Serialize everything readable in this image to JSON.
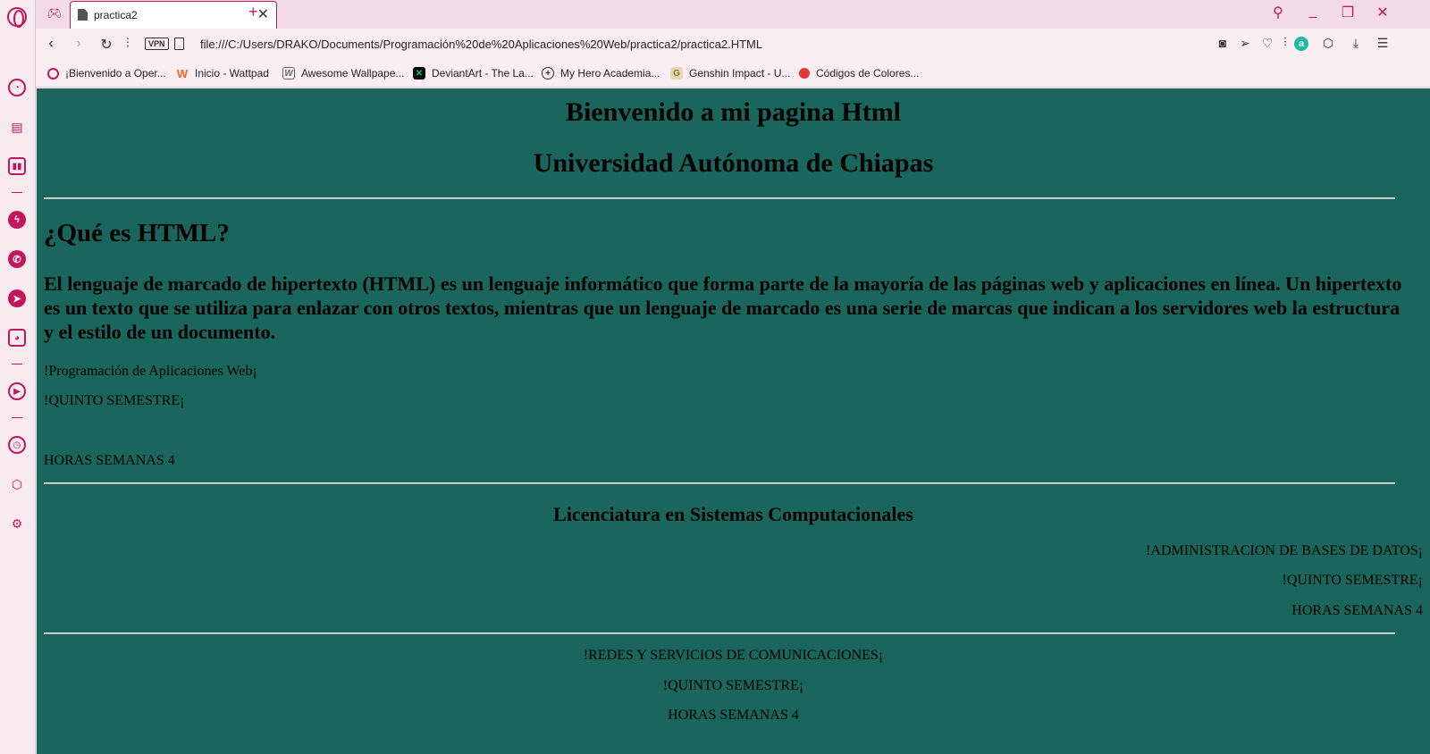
{
  "browser": {
    "tab": {
      "title": "practica2"
    },
    "address": {
      "vpn_label": "VPN",
      "url": "file:///C:/Users/DRAKO/Documents/Programación%20de%20Aplicaciones%20Web/practica2/practica2.HTML"
    },
    "bookmarks": [
      {
        "label": "¡Bienvenido a Oper...",
        "icon": "opera-icon",
        "color": "#c2185b"
      },
      {
        "label": "Inicio - Wattpad",
        "icon": "wattpad-icon",
        "color": "#ff6122"
      },
      {
        "label": "Awesome Wallpape...",
        "icon": "wallpaper-icon",
        "color": "#666666"
      },
      {
        "label": "DeviantArt - The La...",
        "icon": "deviantart-icon",
        "color": "#05cc47"
      },
      {
        "label": "My Hero Academia...",
        "icon": "globe-icon",
        "color": "#333333"
      },
      {
        "label": "Genshin Impact - U...",
        "icon": "genshin-icon",
        "color": "#8a6d3b"
      },
      {
        "label": "Códigos de Colores...",
        "icon": "color-codes-icon",
        "color": "#e53935"
      }
    ],
    "accent_color": "#c2185b"
  },
  "page": {
    "background": "#1a665c",
    "title": "Bienvenido a mi pagina Html",
    "university": "Universidad Autónoma de Chiapas",
    "section_heading": "¿Qué es HTML?",
    "description": "El lenguaje de marcado de hipertexto (HTML) es un lenguaje informático que forma parte de la mayoría de las páginas web y aplicaciones en línea. Un hipertexto es un texto que se utiliza para enlazar con otros textos, mientras que un lenguaje de marcado es una serie de marcas que indican a los servidores web la estructura y el estilo de un documento.",
    "course1": {
      "name": "!Programación de Aplicaciones Web¡",
      "semester": "!QUINTO SEMESTRE¡",
      "hours": "HORAS SEMANAS 4"
    },
    "degree": "Licenciatura en Sistemas Computacionales",
    "course2": {
      "name": "!ADMINISTRACION DE BASES DE DATOS¡",
      "semester": "!QUINTO SEMESTRE¡",
      "hours": "HORAS SEMANAS 4"
    },
    "course3": {
      "name": "!REDES Y SERVICIOS DE COMUNICACIONES¡",
      "semester": "!QUINTO SEMESTRE¡",
      "hours": "HORAS SEMANAS 4"
    }
  }
}
